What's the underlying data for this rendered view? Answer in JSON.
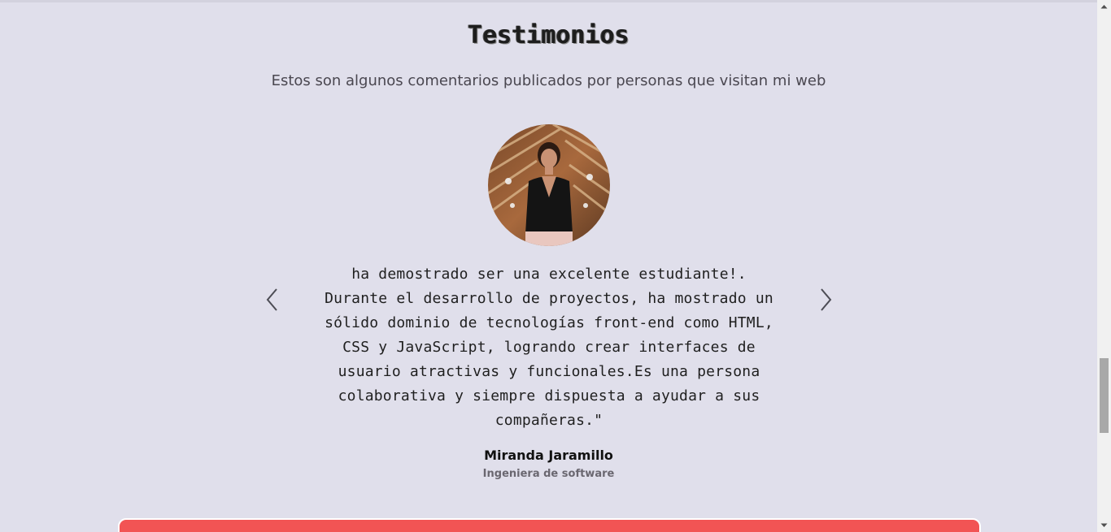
{
  "testimonials": {
    "title": "Testimonios",
    "subtitle": "Estos son algunos comentarios publicados por personas que visitan mi web",
    "quote_lines": [
      "ha demostrado ser una excelente estudiante!.",
      "Durante el desarrollo de proyectos, ha mostrado un",
      "sólido dominio de tecnologías front-end como HTML,",
      "CSS y JavaScript, logrando crear interfaces de",
      "usuario atractivas y funcionales.Es una persona",
      "colaborativa y siempre dispuesta a ayudar a sus",
      "compañeras.\""
    ],
    "author": {
      "name": "Miranda Jaramillo",
      "role": "Ingeniera de software"
    },
    "prev_icon": "chevron-left-icon",
    "next_icon": "chevron-right-icon"
  },
  "colors": {
    "background": "#e0dfeb",
    "accent_red": "#f25454"
  }
}
